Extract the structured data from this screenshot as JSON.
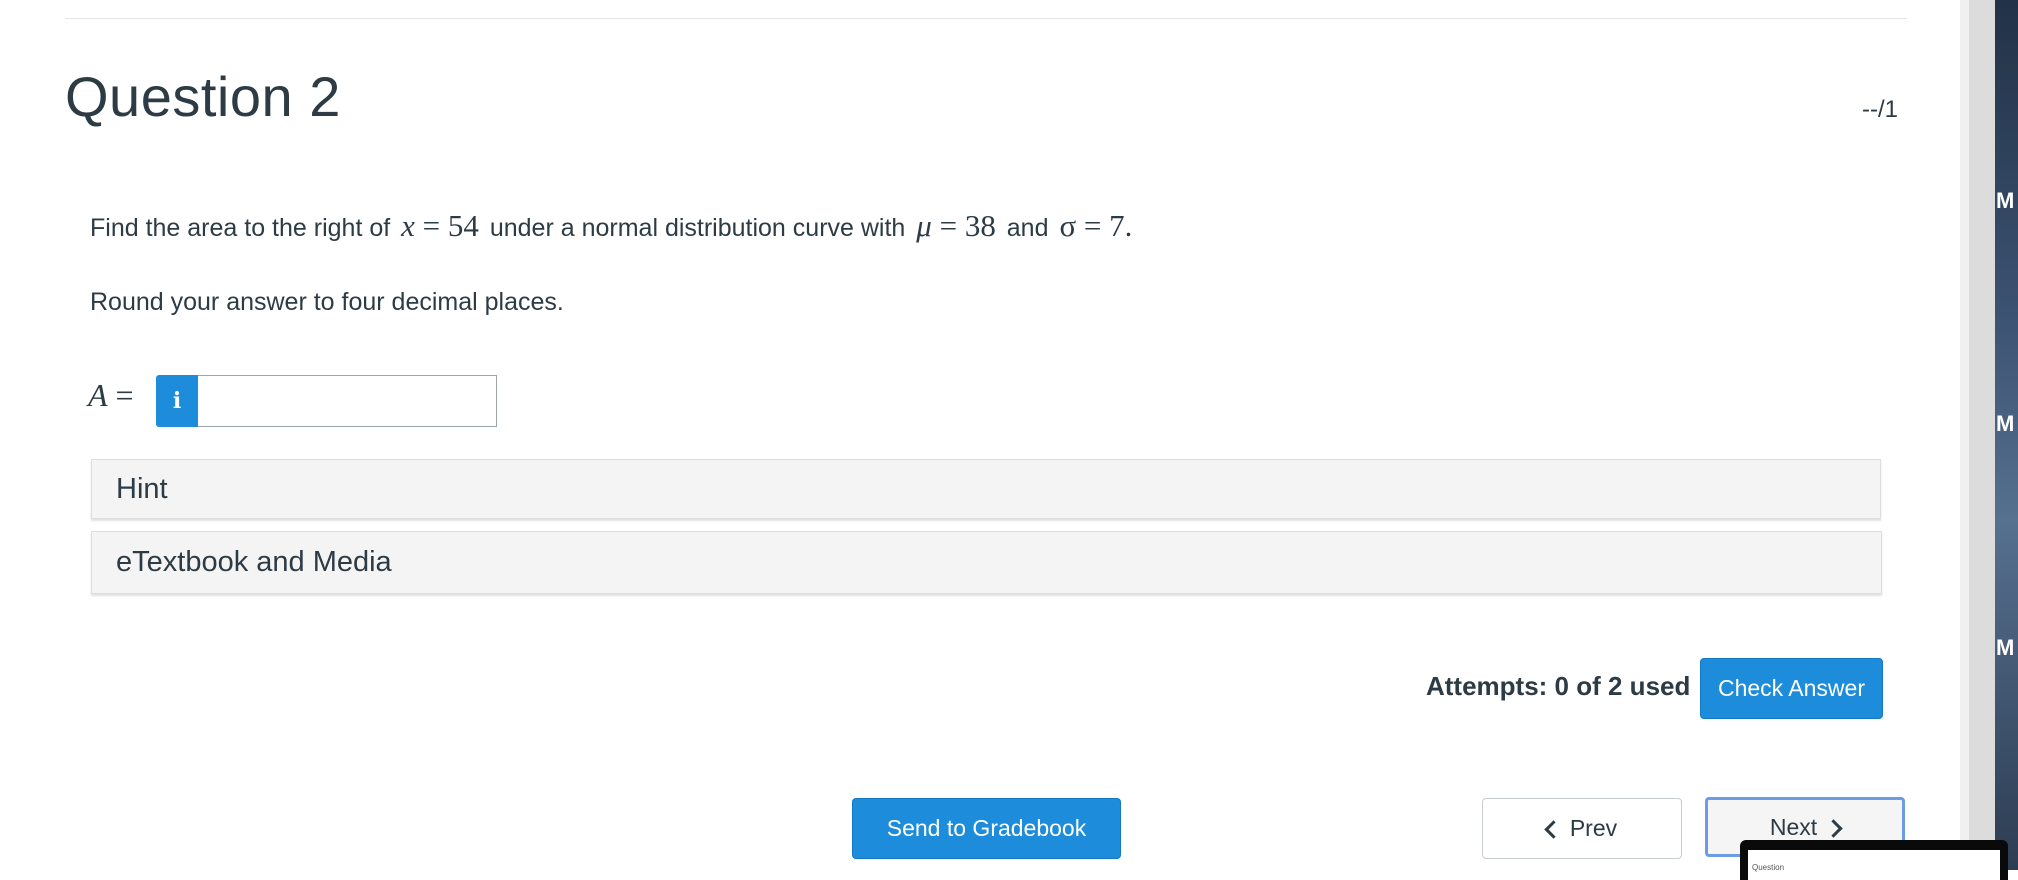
{
  "question": {
    "title": "Question 2",
    "score": "--/1",
    "prompt_pre": "Find the area to the right of",
    "x_var": "x",
    "x_eq": "= 54",
    "prompt_mid": "under a normal distribution curve with",
    "mu_var": "μ",
    "mu_eq": "= 38",
    "and_text": "and",
    "sigma_var": "σ",
    "sigma_eq": "= 7.",
    "round_instruction": "Round your answer to four decimal places.",
    "answer_var": "A",
    "answer_eq": "=",
    "info_glyph": "i",
    "answer_value": ""
  },
  "accordions": {
    "hint": "Hint",
    "etextbook": "eTextbook and Media"
  },
  "attempts": "Attempts: 0 of 2 used",
  "buttons": {
    "check_answer": "Check Answer",
    "send_to_gradebook": "Send to Gradebook",
    "prev": "Prev",
    "next": "Next"
  },
  "right_edge": {
    "letters": [
      "M",
      "M",
      "M"
    ],
    "thumb_text": "Question"
  },
  "icons": {
    "info": "info-icon",
    "prev": "chevron-left-icon",
    "next": "chevron-right-icon"
  },
  "colors": {
    "primary": "#1c8cdb",
    "text": "#2d3b45",
    "accordion_bg": "#f4f4f4",
    "focus_ring": "#6b9de6"
  }
}
